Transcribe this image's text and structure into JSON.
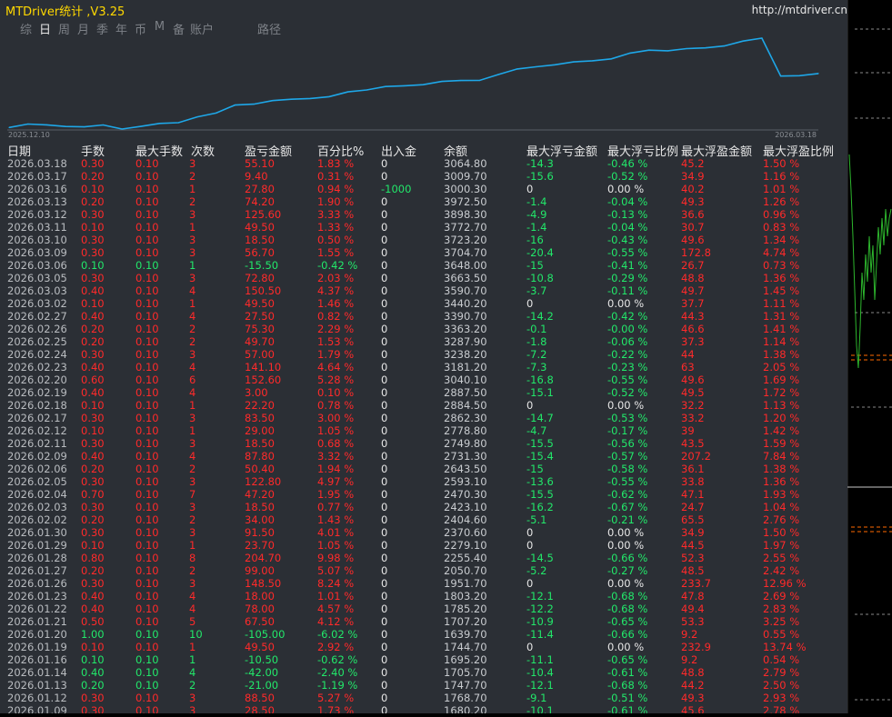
{
  "app": {
    "title": "MTDriver统计 ,V3.25",
    "url": "http://mtdriver.cn"
  },
  "tabs": [
    {
      "label": "综",
      "active": false
    },
    {
      "label": "日",
      "active": true
    },
    {
      "label": "周",
      "active": false
    },
    {
      "label": "月",
      "active": false
    },
    {
      "label": "季",
      "active": false
    },
    {
      "label": "年",
      "active": false
    },
    {
      "label": "币",
      "active": false
    },
    {
      "label": "M",
      "active": false
    },
    {
      "label": "备",
      "active": false
    },
    {
      "label": "账户",
      "active": false
    },
    {
      "label": "路径",
      "active": false
    }
  ],
  "chart_data": {
    "type": "line",
    "x_start_label": "2025.12.10",
    "x_end_label": "2026.03.18",
    "series": [
      {
        "color": "#1ea7e8",
        "values": [
          1680.2,
          1768.7,
          1747.7,
          1705.7,
          1695.2,
          1744.7,
          1639.7,
          1707.2,
          1785.2,
          1803.2,
          1951.7,
          2050.7,
          2255.4,
          2279.1,
          2370.6,
          2404.6,
          2423.1,
          2470.3,
          2593.1,
          2643.5,
          2731.3,
          2749.8,
          2778.8,
          2862.3,
          2884.5,
          2887.5,
          3040.1,
          3181.2,
          3238.2,
          3287.9,
          3363.2,
          3390.7,
          3440.2,
          3590.7,
          3663.5,
          3648.0,
          3704.7,
          3723.2,
          3772.7,
          3898.3,
          3972.5,
          3000.3,
          3009.7,
          3064.8
        ]
      }
    ]
  },
  "columns": {
    "date": "日期",
    "lots": "手数",
    "max_lot": "最大手数",
    "count": "次数",
    "pl": "盈亏金额",
    "pct": "百分比%",
    "io": "出入金",
    "balance": "余额",
    "max_float_loss": "最大浮亏金额",
    "max_float_loss_pct": "最大浮亏比例",
    "max_float_gain": "最大浮盈金额",
    "max_float_gain_pct": "最大浮盈比例"
  },
  "rows": [
    [
      "2026.03.18",
      "0.30",
      "0.10",
      "3",
      "55.10",
      "1.83 %",
      "0",
      "3064.80",
      "-14.3",
      "-0.46 %",
      "45.2",
      "1.50 %"
    ],
    [
      "2026.03.17",
      "0.20",
      "0.10",
      "2",
      "9.40",
      "0.31 %",
      "0",
      "3009.70",
      "-15.6",
      "-0.52 %",
      "34.9",
      "1.16 %"
    ],
    [
      "2026.03.16",
      "0.10",
      "0.10",
      "1",
      "27.80",
      "0.94 %",
      "-1000",
      "3000.30",
      "0",
      "0.00 %",
      "40.2",
      "1.01 %"
    ],
    [
      "2026.03.13",
      "0.20",
      "0.10",
      "2",
      "74.20",
      "1.90 %",
      "0",
      "3972.50",
      "-1.4",
      "-0.04 %",
      "49.3",
      "1.26 %"
    ],
    [
      "2026.03.12",
      "0.30",
      "0.10",
      "3",
      "125.60",
      "3.33 %",
      "0",
      "3898.30",
      "-4.9",
      "-0.13 %",
      "36.6",
      "0.96 %"
    ],
    [
      "2026.03.11",
      "0.10",
      "0.10",
      "1",
      "49.50",
      "1.33 %",
      "0",
      "3772.70",
      "-1.4",
      "-0.04 %",
      "30.7",
      "0.83 %"
    ],
    [
      "2026.03.10",
      "0.30",
      "0.10",
      "3",
      "18.50",
      "0.50 %",
      "0",
      "3723.20",
      "-16",
      "-0.43 %",
      "49.6",
      "1.34 %"
    ],
    [
      "2026.03.09",
      "0.30",
      "0.10",
      "3",
      "56.70",
      "1.55 %",
      "0",
      "3704.70",
      "-20.4",
      "-0.55 %",
      "172.8",
      "4.74 %"
    ],
    [
      "2026.03.06",
      "0.10",
      "0.10",
      "1",
      "-15.50",
      "-0.42 %",
      "0",
      "3648.00",
      "-15",
      "-0.41 %",
      "26.7",
      "0.73 %"
    ],
    [
      "2026.03.05",
      "0.30",
      "0.10",
      "3",
      "72.80",
      "2.03 %",
      "0",
      "3663.50",
      "-10.8",
      "-0.29 %",
      "48.8",
      "1.36 %"
    ],
    [
      "2026.03.03",
      "0.40",
      "0.10",
      "4",
      "150.50",
      "4.37 %",
      "0",
      "3590.70",
      "-3.7",
      "-0.11 %",
      "49.7",
      "1.45 %"
    ],
    [
      "2026.03.02",
      "0.10",
      "0.10",
      "1",
      "49.50",
      "1.46 %",
      "0",
      "3440.20",
      "0",
      "0.00 %",
      "37.7",
      "1.11 %"
    ],
    [
      "2026.02.27",
      "0.40",
      "0.10",
      "4",
      "27.50",
      "0.82 %",
      "0",
      "3390.70",
      "-14.2",
      "-0.42 %",
      "44.3",
      "1.31 %"
    ],
    [
      "2026.02.26",
      "0.20",
      "0.10",
      "2",
      "75.30",
      "2.29 %",
      "0",
      "3363.20",
      "-0.1",
      "-0.00 %",
      "46.6",
      "1.41 %"
    ],
    [
      "2026.02.25",
      "0.20",
      "0.10",
      "2",
      "49.70",
      "1.53 %",
      "0",
      "3287.90",
      "-1.8",
      "-0.06 %",
      "37.3",
      "1.14 %"
    ],
    [
      "2026.02.24",
      "0.30",
      "0.10",
      "3",
      "57.00",
      "1.79 %",
      "0",
      "3238.20",
      "-7.2",
      "-0.22 %",
      "44",
      "1.38 %"
    ],
    [
      "2026.02.23",
      "0.40",
      "0.10",
      "4",
      "141.10",
      "4.64 %",
      "0",
      "3181.20",
      "-7.3",
      "-0.23 %",
      "63",
      "2.05 %"
    ],
    [
      "2026.02.20",
      "0.60",
      "0.10",
      "6",
      "152.60",
      "5.28 %",
      "0",
      "3040.10",
      "-16.8",
      "-0.55 %",
      "49.6",
      "1.69 %"
    ],
    [
      "2026.02.19",
      "0.40",
      "0.10",
      "4",
      "3.00",
      "0.10 %",
      "0",
      "2887.50",
      "-15.1",
      "-0.52 %",
      "49.5",
      "1.72 %"
    ],
    [
      "2026.02.18",
      "0.10",
      "0.10",
      "1",
      "22.20",
      "0.78 %",
      "0",
      "2884.50",
      "0",
      "0.00 %",
      "32.2",
      "1.13 %"
    ],
    [
      "2026.02.17",
      "0.30",
      "0.10",
      "3",
      "83.50",
      "3.00 %",
      "0",
      "2862.30",
      "-14.7",
      "-0.53 %",
      "33.2",
      "1.20 %"
    ],
    [
      "2026.02.12",
      "0.10",
      "0.10",
      "1",
      "29.00",
      "1.05 %",
      "0",
      "2778.80",
      "-4.7",
      "-0.17 %",
      "39",
      "1.42 %"
    ],
    [
      "2026.02.11",
      "0.30",
      "0.10",
      "3",
      "18.50",
      "0.68 %",
      "0",
      "2749.80",
      "-15.5",
      "-0.56 %",
      "43.5",
      "1.59 %"
    ],
    [
      "2026.02.09",
      "0.40",
      "0.10",
      "4",
      "87.80",
      "3.32 %",
      "0",
      "2731.30",
      "-15.4",
      "-0.57 %",
      "207.2",
      "7.84 %"
    ],
    [
      "2026.02.06",
      "0.20",
      "0.10",
      "2",
      "50.40",
      "1.94 %",
      "0",
      "2643.50",
      "-15",
      "-0.58 %",
      "36.1",
      "1.38 %"
    ],
    [
      "2026.02.05",
      "0.30",
      "0.10",
      "3",
      "122.80",
      "4.97 %",
      "0",
      "2593.10",
      "-13.6",
      "-0.55 %",
      "33.8",
      "1.36 %"
    ],
    [
      "2026.02.04",
      "0.70",
      "0.10",
      "7",
      "47.20",
      "1.95 %",
      "0",
      "2470.30",
      "-15.5",
      "-0.62 %",
      "47.1",
      "1.93 %"
    ],
    [
      "2026.02.03",
      "0.30",
      "0.10",
      "3",
      "18.50",
      "0.77 %",
      "0",
      "2423.10",
      "-16.2",
      "-0.67 %",
      "24.7",
      "1.04 %"
    ],
    [
      "2026.02.02",
      "0.20",
      "0.10",
      "2",
      "34.00",
      "1.43 %",
      "0",
      "2404.60",
      "-5.1",
      "-0.21 %",
      "65.5",
      "2.76 %"
    ],
    [
      "2026.01.30",
      "0.30",
      "0.10",
      "3",
      "91.50",
      "4.01 %",
      "0",
      "2370.60",
      "0",
      "0.00 %",
      "34.9",
      "1.50 %"
    ],
    [
      "2026.01.29",
      "0.10",
      "0.10",
      "1",
      "23.70",
      "1.05 %",
      "0",
      "2279.10",
      "0",
      "0.00 %",
      "44.5",
      "1.97 %"
    ],
    [
      "2026.01.28",
      "0.80",
      "0.10",
      "8",
      "204.70",
      "9.98 %",
      "0",
      "2255.40",
      "-14.5",
      "-0.66 %",
      "52.3",
      "2.55 %"
    ],
    [
      "2026.01.27",
      "0.20",
      "0.10",
      "2",
      "99.00",
      "5.07 %",
      "0",
      "2050.70",
      "-5.2",
      "-0.27 %",
      "48.5",
      "2.42 %"
    ],
    [
      "2026.01.26",
      "0.30",
      "0.10",
      "3",
      "148.50",
      "8.24 %",
      "0",
      "1951.70",
      "0",
      "0.00 %",
      "233.7",
      "12.96 %"
    ],
    [
      "2026.01.23",
      "0.40",
      "0.10",
      "4",
      "18.00",
      "1.01 %",
      "0",
      "1803.20",
      "-12.1",
      "-0.68 %",
      "47.8",
      "2.69 %"
    ],
    [
      "2026.01.22",
      "0.40",
      "0.10",
      "4",
      "78.00",
      "4.57 %",
      "0",
      "1785.20",
      "-12.2",
      "-0.68 %",
      "49.4",
      "2.83 %"
    ],
    [
      "2026.01.21",
      "0.50",
      "0.10",
      "5",
      "67.50",
      "4.12 %",
      "0",
      "1707.20",
      "-10.9",
      "-0.65 %",
      "53.3",
      "3.25 %"
    ],
    [
      "2026.01.20",
      "1.00",
      "0.10",
      "10",
      "-105.00",
      "-6.02 %",
      "0",
      "1639.70",
      "-11.4",
      "-0.66 %",
      "9.2",
      "0.55 %"
    ],
    [
      "2026.01.19",
      "0.10",
      "0.10",
      "1",
      "49.50",
      "2.92 %",
      "0",
      "1744.70",
      "0",
      "0.00 %",
      "232.9",
      "13.74 %"
    ],
    [
      "2026.01.16",
      "0.10",
      "0.10",
      "1",
      "-10.50",
      "-0.62 %",
      "0",
      "1695.20",
      "-11.1",
      "-0.65 %",
      "9.2",
      "0.54 %"
    ],
    [
      "2026.01.14",
      "0.40",
      "0.10",
      "4",
      "-42.00",
      "-2.40 %",
      "0",
      "1705.70",
      "-10.4",
      "-0.61 %",
      "48.8",
      "2.79 %"
    ],
    [
      "2026.01.13",
      "0.20",
      "0.10",
      "2",
      "-21.00",
      "-1.19 %",
      "0",
      "1747.70",
      "-12.1",
      "-0.68 %",
      "44.2",
      "2.50 %"
    ],
    [
      "2026.01.12",
      "0.30",
      "0.10",
      "3",
      "88.50",
      "5.27 %",
      "0",
      "1768.70",
      "-9.1",
      "-0.51 %",
      "49.3",
      "2.93 %"
    ],
    [
      "2026.01.09",
      "0.30",
      "0.10",
      "3",
      "28.50",
      "1.73 %",
      "0",
      "1680.20",
      "-10.1",
      "-0.61 %",
      "45.6",
      "2.78 %"
    ]
  ],
  "colors": {
    "profit": "#ff2a2a",
    "loss": "#22e76a",
    "line": "#1ea7e8",
    "title": "#ffd800"
  }
}
